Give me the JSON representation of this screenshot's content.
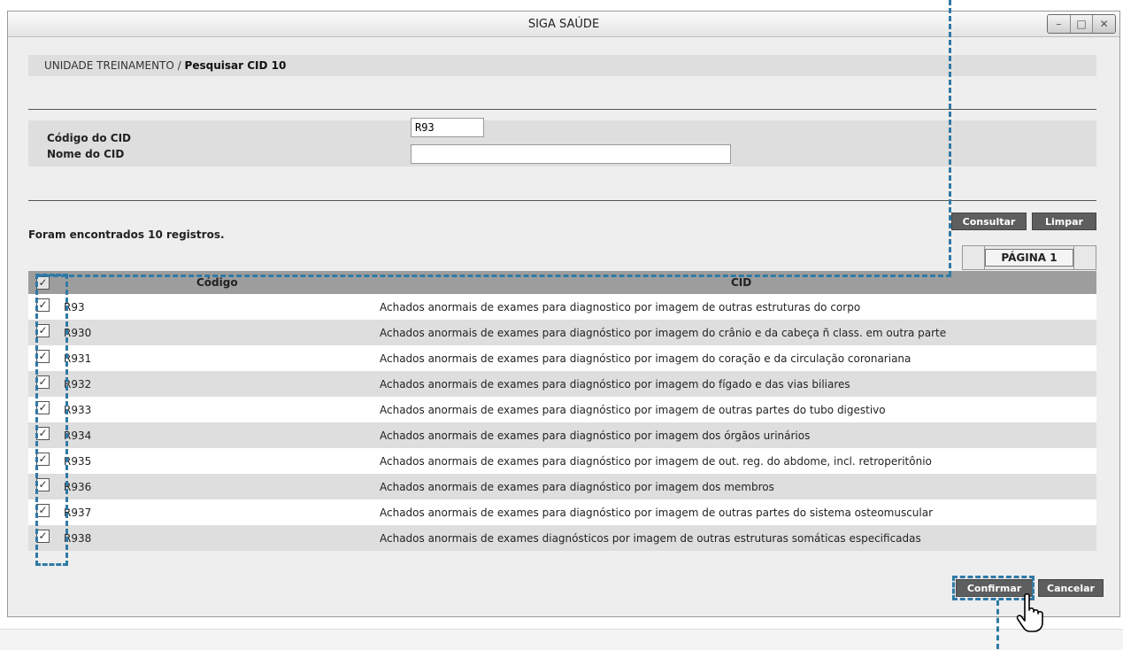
{
  "window": {
    "title": "SIGA SAÚDE",
    "controls": [
      "minimize-icon",
      "maximize-icon",
      "close-icon"
    ]
  },
  "breadcrumb": {
    "unit": "UNIDADE TREINAMENTO /",
    "page": "Pesquisar CID 10"
  },
  "form": {
    "code_label": "Código do CID",
    "code_value": "R93",
    "name_label": "Nome do CID",
    "name_value": ""
  },
  "actions": {
    "consultar": "Consultar",
    "limpar": "Limpar",
    "confirmar": "Confirmar",
    "cancelar": "Cancelar"
  },
  "results": {
    "summary": "Foram encontrados 10 registros.",
    "page_label": "PÁGINA 1"
  },
  "table": {
    "headers": {
      "code": "Código",
      "cid": "CID"
    },
    "rows": [
      {
        "checked": true,
        "code": "R93",
        "cid": "Achados anormais de exames para diagnostico por imagem de outras estruturas do corpo"
      },
      {
        "checked": true,
        "code": "R930",
        "cid": "Achados anormais de exames para diagnóstico por imagem do crânio e da cabeça ñ class. em outra parte"
      },
      {
        "checked": true,
        "code": "R931",
        "cid": "Achados anormais de exames para diagnóstico por imagem do coração e da circulação coronariana"
      },
      {
        "checked": true,
        "code": "R932",
        "cid": "Achados anormais de exames para diagnóstico por imagem do fígado e das vias biliares"
      },
      {
        "checked": true,
        "code": "R933",
        "cid": "Achados anormais de exames para diagnóstico por imagem de outras partes do tubo digestivo"
      },
      {
        "checked": true,
        "code": "R934",
        "cid": "Achados anormais de exames para diagnóstico por imagem dos órgãos urinários"
      },
      {
        "checked": true,
        "code": "R935",
        "cid": "Achados anormais de exames para diagnóstico por imagem de out. reg. do abdome, incl. retroperitônio"
      },
      {
        "checked": true,
        "code": "R936",
        "cid": "Achados anormais de exames para diagnóstico por imagem dos membros"
      },
      {
        "checked": true,
        "code": "R937",
        "cid": "Achados anormais de exames para diagnóstico por imagem de outras partes do sistema osteomuscular"
      },
      {
        "checked": true,
        "code": "R938",
        "cid": "Achados anormais de exames diagnósticos por imagem de outras estruturas somáticas especificadas"
      }
    ]
  },
  "colors": {
    "highlight_dash": "#2f7aa5",
    "button_bg": "#5e5e5e",
    "header_bg": "#9d9d9d"
  }
}
